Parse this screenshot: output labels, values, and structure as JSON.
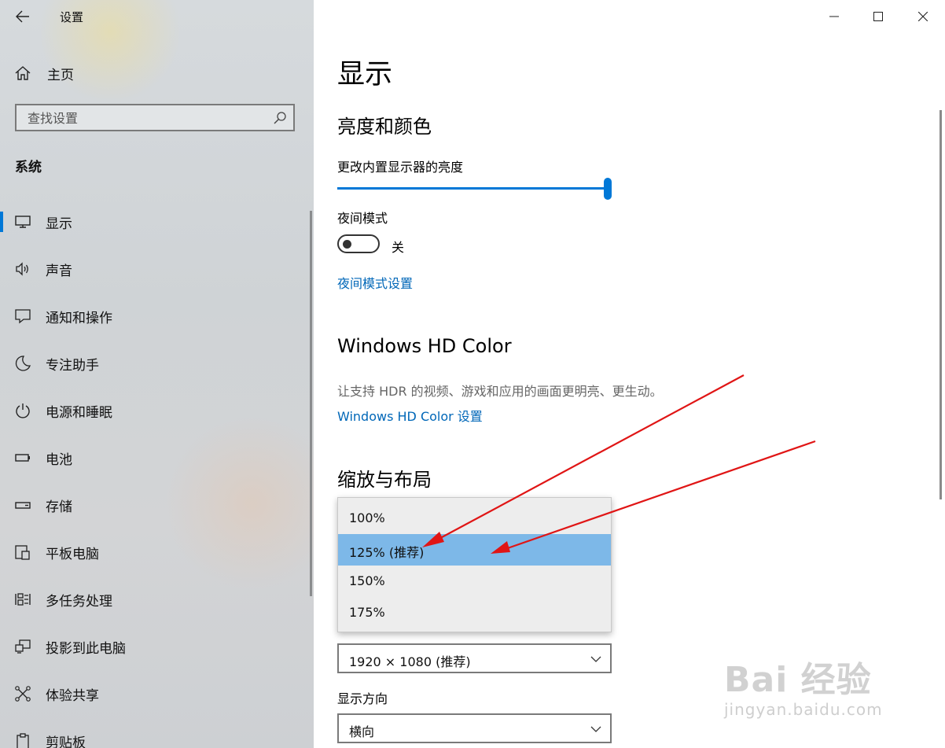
{
  "window": {
    "title": "设置"
  },
  "sidebar": {
    "home_label": "主页",
    "search_placeholder": "查找设置",
    "section": "系统",
    "items": [
      {
        "label": "显示",
        "icon": "monitor-icon",
        "active": true
      },
      {
        "label": "声音",
        "icon": "speaker-icon"
      },
      {
        "label": "通知和操作",
        "icon": "notification-icon"
      },
      {
        "label": "专注助手",
        "icon": "moon-icon"
      },
      {
        "label": "电源和睡眠",
        "icon": "power-icon"
      },
      {
        "label": "电池",
        "icon": "battery-icon"
      },
      {
        "label": "存储",
        "icon": "storage-icon"
      },
      {
        "label": "平板电脑",
        "icon": "tablet-icon"
      },
      {
        "label": "多任务处理",
        "icon": "multitask-icon"
      },
      {
        "label": "投影到此电脑",
        "icon": "project-icon"
      },
      {
        "label": "体验共享",
        "icon": "share-icon"
      },
      {
        "label": "剪贴板",
        "icon": "clipboard-icon"
      }
    ]
  },
  "main": {
    "title": "显示",
    "brightness_section": "亮度和颜色",
    "brightness_label": "更改内置显示器的亮度",
    "brightness_value": 1.0,
    "night_mode_label": "夜间模式",
    "night_mode_state": "关",
    "night_mode_link": "夜间模式设置",
    "hd_section": "Windows HD Color",
    "hd_description": "让支持 HDR 的视频、游戏和应用的画面更明亮、更生动。",
    "hd_link": "Windows HD Color 设置",
    "scale_section": "缩放与布局",
    "scale_options": [
      "100%",
      "125% (推荐)",
      "150%",
      "175%"
    ],
    "scale_selected": "125% (推荐)",
    "resolution_value": "1920 × 1080 (推荐)",
    "orientation_label": "显示方向",
    "orientation_value": "横向"
  },
  "watermark": {
    "brand": "Bai 经验",
    "sub": "jingyan.baidu.com"
  },
  "colors": {
    "accent": "#0078d7",
    "link": "#0067b8",
    "selected": "#7db8e8",
    "annotation_arrow": "#e01515"
  }
}
